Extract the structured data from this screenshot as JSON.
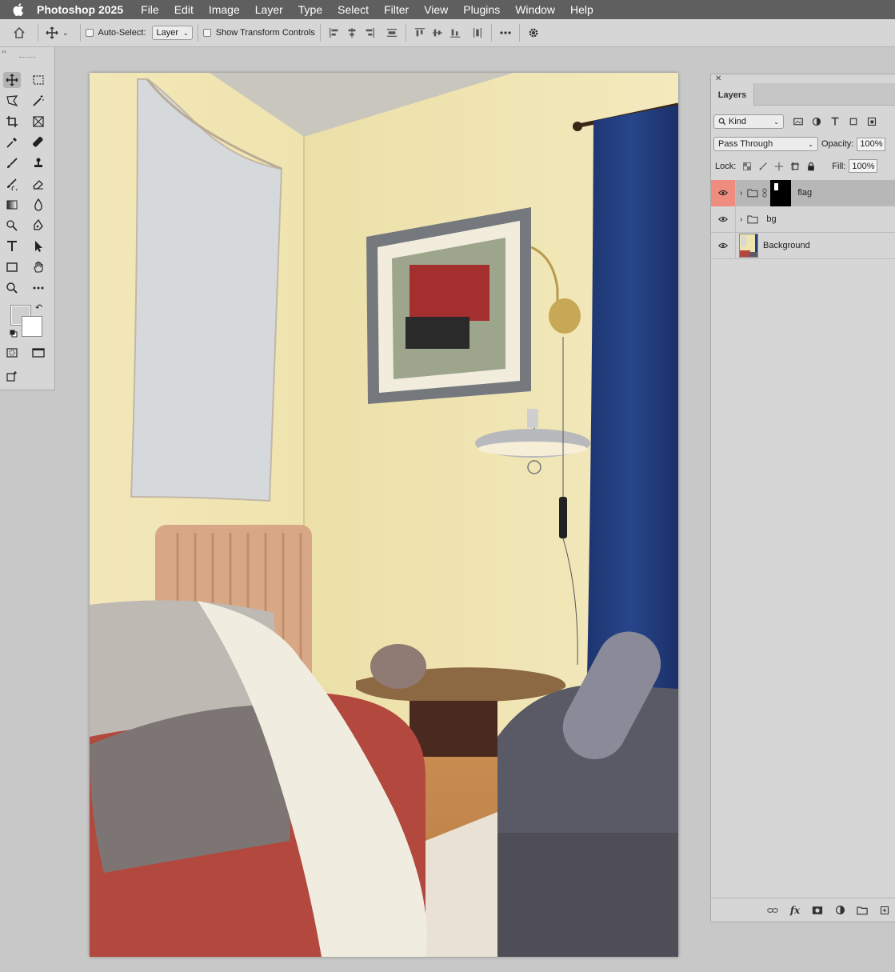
{
  "menubar": {
    "app_name": "Photoshop 2025",
    "items": [
      "File",
      "Edit",
      "Image",
      "Layer",
      "Type",
      "Select",
      "Filter",
      "View",
      "Plugins",
      "Window",
      "Help"
    ]
  },
  "options_bar": {
    "auto_select_label": "Auto-Select:",
    "auto_select_value": "Layer",
    "show_transform_label": "Show Transform Controls"
  },
  "toolbar": {
    "collapse_glyph": "‹‹",
    "foreground_color": "#cfcfcf",
    "background_color": "#ffffff"
  },
  "canvas": {
    "wall_color": "#f0e6b8",
    "curtain_color": "#223f7a",
    "flag_color": "#d5d8da"
  },
  "layers_panel": {
    "close_glyph": "✕",
    "tab_label": "Layers",
    "filter_kind": "Kind",
    "blend_mode": "Pass Through",
    "opacity_label": "Opacity:",
    "opacity_value": "100%",
    "lock_label": "Lock:",
    "fill_label": "Fill:",
    "fill_value": "100%",
    "layers": [
      {
        "name": "flag",
        "type": "group",
        "selected": true,
        "has_mask": true
      },
      {
        "name": "bg",
        "type": "group",
        "selected": false
      },
      {
        "name": "Background",
        "type": "image",
        "selected": false
      }
    ]
  }
}
